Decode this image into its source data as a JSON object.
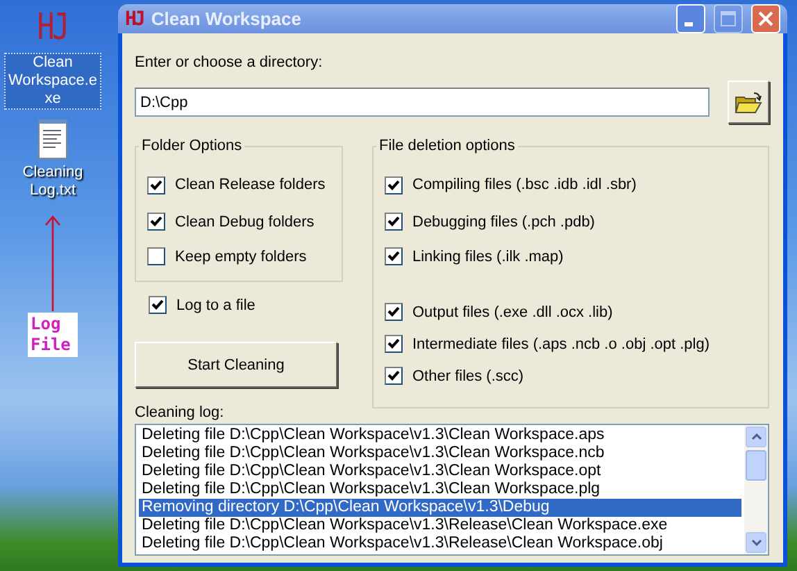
{
  "desktop": {
    "icons": [
      {
        "kind": "app",
        "logo": "HJ",
        "label": "Clean Workspace.exe",
        "selected": true
      },
      {
        "kind": "text-file",
        "label": "Cleaning Log.txt",
        "selected": false
      }
    ],
    "annotation": {
      "label": "Log File"
    }
  },
  "window": {
    "logo": "HJ",
    "title": "Clean Workspace",
    "title_buttons": [
      {
        "kind": "minimize",
        "disabled": false
      },
      {
        "kind": "maximize",
        "disabled": true
      },
      {
        "kind": "close",
        "disabled": false
      }
    ]
  },
  "directory": {
    "label": "Enter or choose a directory:",
    "value": "D:\\Cpp"
  },
  "folder_options": {
    "title": "Folder Options",
    "items": [
      {
        "label": "Clean Release folders",
        "checked": true
      },
      {
        "label": "Clean Debug folders",
        "checked": true
      },
      {
        "label": "Keep empty folders",
        "checked": false
      }
    ]
  },
  "log_to_file": {
    "label": "Log to a file",
    "checked": true
  },
  "start_button": "Start Cleaning",
  "file_options": {
    "title": "File deletion options",
    "groups": [
      [
        {
          "label": "Compiling files (.bsc .idb .idl .sbr)",
          "checked": true
        },
        {
          "label": "Debugging files (.pch .pdb)",
          "checked": true
        },
        {
          "label": "Linking files (.ilk .map)",
          "checked": true
        }
      ],
      [
        {
          "label": "Output files (.exe .dll .ocx .lib)",
          "checked": true
        },
        {
          "label": "Intermediate files (.aps .ncb .o .obj .opt .plg)",
          "checked": true
        },
        {
          "label": "Other files (.scc)",
          "checked": true
        }
      ]
    ]
  },
  "log": {
    "label": "Cleaning log:",
    "lines": [
      {
        "text": "Deleting file D:\\Cpp\\Clean Workspace\\v1.3\\Clean Workspace.aps",
        "selected": false
      },
      {
        "text": "Deleting file D:\\Cpp\\Clean Workspace\\v1.3\\Clean Workspace.ncb",
        "selected": false
      },
      {
        "text": "Deleting file D:\\Cpp\\Clean Workspace\\v1.3\\Clean Workspace.opt",
        "selected": false
      },
      {
        "text": "Deleting file D:\\Cpp\\Clean Workspace\\v1.3\\Clean Workspace.plg",
        "selected": false
      },
      {
        "text": "Removing directory D:\\Cpp\\Clean Workspace\\v1.3\\Debug",
        "selected": true
      },
      {
        "text": "Deleting file D:\\Cpp\\Clean Workspace\\v1.3\\Release\\Clean Workspace.exe",
        "selected": false
      },
      {
        "text": "Deleting file D:\\Cpp\\Clean Workspace\\v1.3\\Release\\Clean Workspace.obj",
        "selected": false
      }
    ]
  }
}
